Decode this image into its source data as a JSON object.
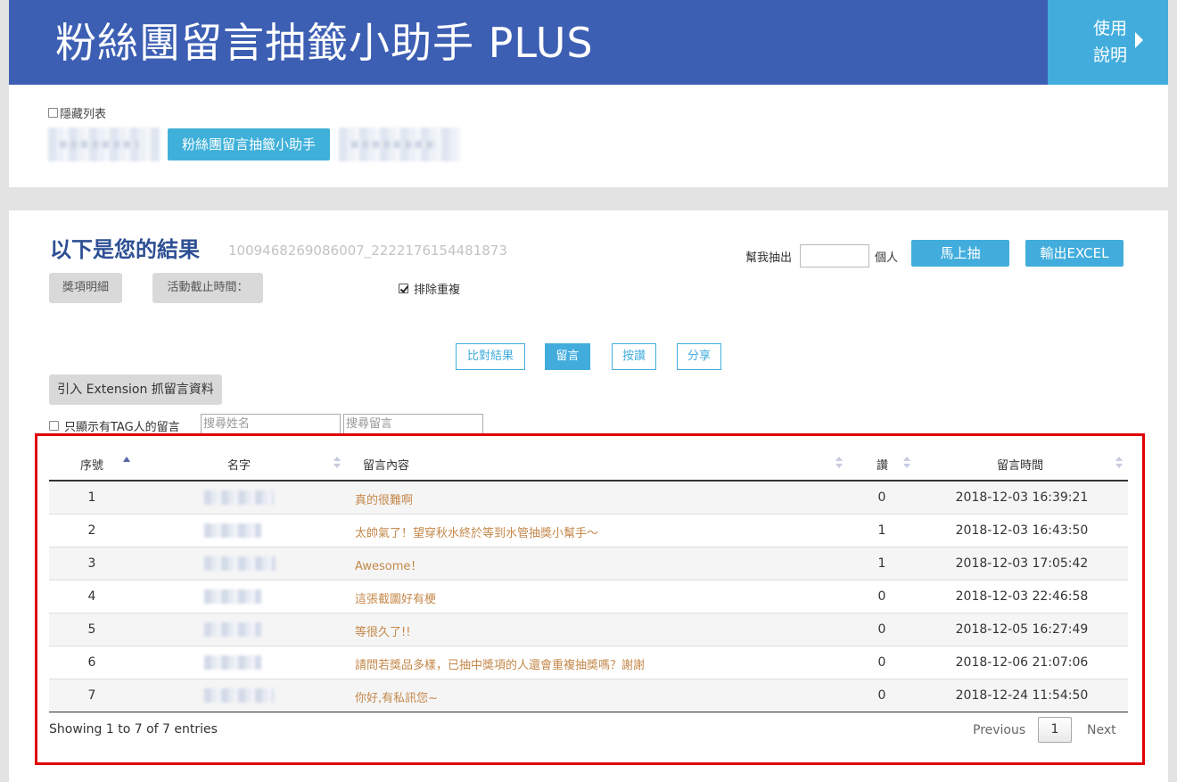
{
  "header": {
    "title": "粉絲團留言抽籤小助手 PLUS",
    "help_label_1": "使用",
    "help_label_2": "說明"
  },
  "top": {
    "hide_list_label": "隱藏列表",
    "tool_button": "粉絲團留言抽籤小助手"
  },
  "result": {
    "title": "以下是您的結果",
    "post_id": "1009468269086007_2222176154481873",
    "prize_details": "獎項明細",
    "deadline": "活動截止時間：",
    "exclude_duplicates": "排除重複",
    "exclude_checked": true,
    "draw_label": "幫我抽出",
    "draw_count": "",
    "draw_unit": "個人",
    "draw_button": "馬上抽",
    "export_button": "輸出EXCEL"
  },
  "tabs": [
    {
      "label": "比對結果",
      "active": false
    },
    {
      "label": "留言",
      "active": true
    },
    {
      "label": "按讚",
      "active": false
    },
    {
      "label": "分享",
      "active": false
    }
  ],
  "extension_button": "引入 Extension 抓留言資料",
  "filters": {
    "tag_only_label": "只顯示有TAG人的留言",
    "search_name_placeholder": "搜尋姓名",
    "search_comment_placeholder": "搜尋留言"
  },
  "table": {
    "columns": [
      "序號",
      "名字",
      "留言內容",
      "讚",
      "留言時間"
    ],
    "rows": [
      {
        "no": "1",
        "content": "真的很難啊",
        "likes": "0",
        "time": "2018-12-03 16:39:21"
      },
      {
        "no": "2",
        "content": "太帥氣了！望穿秋水終於等到水管抽獎小幫手～",
        "likes": "1",
        "time": "2018-12-03 16:43:50"
      },
      {
        "no": "3",
        "content": "Awesome！",
        "likes": "1",
        "time": "2018-12-03 17:05:42"
      },
      {
        "no": "4",
        "content": "這張截圖好有梗",
        "likes": "0",
        "time": "2018-12-03 22:46:58"
      },
      {
        "no": "5",
        "content": "等很久了!!",
        "likes": "0",
        "time": "2018-12-05 16:27:49"
      },
      {
        "no": "6",
        "content": "請問若獎品多樣，已抽中獎項的人還會重複抽獎嗎？謝謝",
        "likes": "0",
        "time": "2018-12-06 21:07:06"
      },
      {
        "no": "7",
        "content": "你好,有私訊您~",
        "likes": "0",
        "time": "2018-12-24 11:54:50"
      }
    ],
    "info": "Showing 1 to 7 of 7 entries",
    "prev": "Previous",
    "page": "1",
    "next": "Next"
  },
  "colors": {
    "header_bg": "#3d5fb3",
    "accent": "#42addc",
    "comment_text": "#c4884a",
    "highlight_frame": "#e00000"
  }
}
